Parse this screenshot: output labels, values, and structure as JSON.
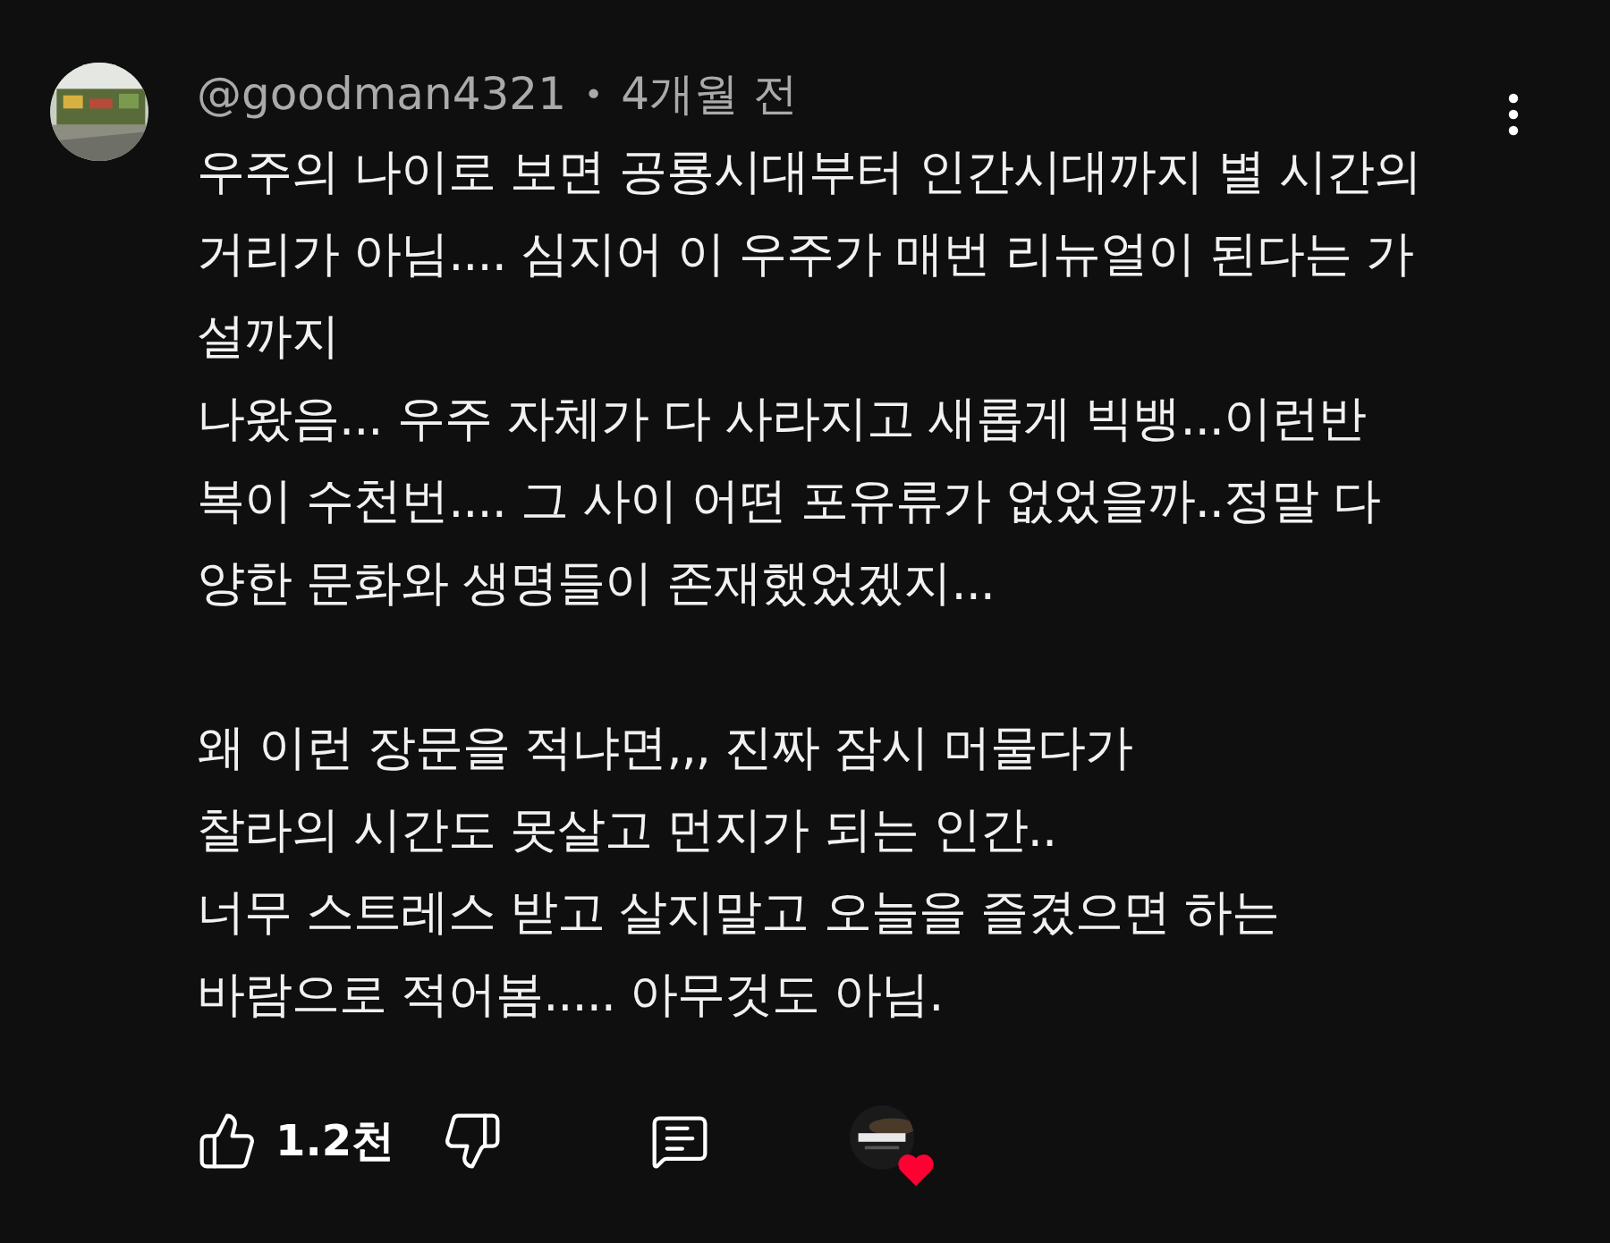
{
  "comment": {
    "author": "@goodman4321",
    "separator": "•",
    "time": "4개월 전",
    "paragraphs": [
      "우주의 나이로 보면 공룡시대부터 인간시대까지 별 시간의\n거리가 아님.... 심지어 이 우주가 매번 리뉴얼이 된다는 가\n설까지\n나왔음... 우주 자체가 다 사라지고 새롭게 빅뱅...이런반\n복이 수천번.... 그 사이 어떤 포유류가 없었을까..정말 다\n양한 문화와 생명들이 존재했었겠지...",
      "왜 이런 장문을 적냐면,,, 진짜 잠시 머물다가\n찰라의 시간도 못살고 먼지가 되는 인간..\n너무 스트레스 받고 살지말고 오늘을 즐겼으면 하는\n바람으로 적어봄..... 아무것도 아님."
    ],
    "like_count": "1.2천",
    "creator_hearted": true
  }
}
